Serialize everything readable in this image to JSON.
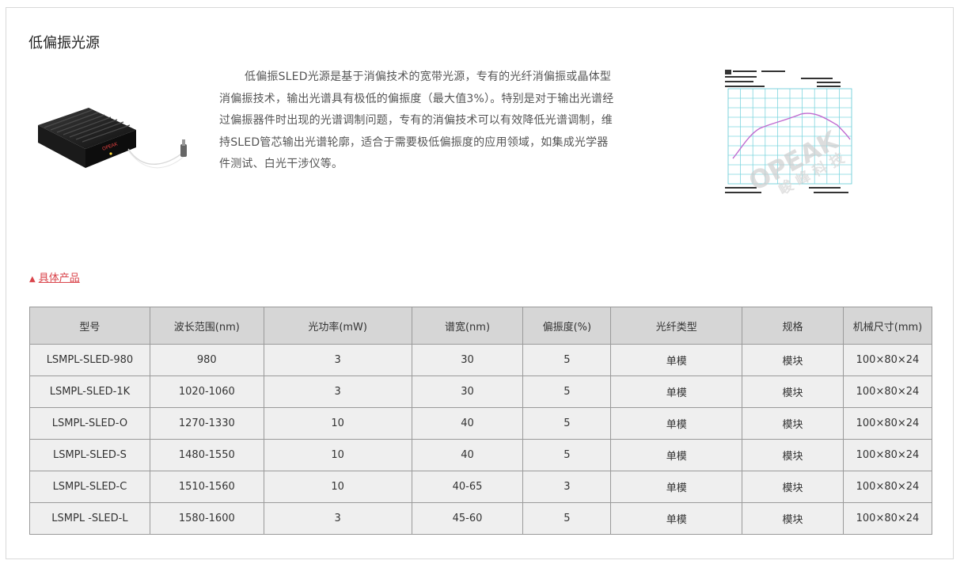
{
  "page": {
    "title": "低偏振光源",
    "description": "低偏振SLED光源是基于消偏技术的宽带光源，专有的光纤消偏振或晶体型消偏振技术，输出光谱具有极低的偏振度（最大值3%）。特别是对于输出光谱经过偏振器件时出现的光谱调制问题，专有的消偏技术可以有效降低光谱调制，维持SLED管芯输出光谱轮廓，适合于需要极低偏振度的应用领域，如集成光学器件测试、白光干涉仪等。",
    "products_link": "具体产品",
    "product_image_label": "OPEAK",
    "spectrum_watermark": "OPEAK",
    "spectrum_watermark_cn": "峻 峰 科 技"
  },
  "colors": {
    "link": "#d9434a",
    "header_bg": "#d6d6d6",
    "cell_bg": "#efefef",
    "border": "#9a9a9a",
    "trace": "#c06ad0",
    "grid": "#7fd6df"
  },
  "table": {
    "headers": [
      "型号",
      "波长范围(nm)",
      "光功率(mW)",
      "谱宽(nm)",
      "偏振度(%)",
      "光纤类型",
      "规格",
      "机械尺寸(mm)"
    ],
    "rows": [
      [
        "LSMPL-SLED-980",
        "980",
        "3",
        "30",
        "5",
        "单模",
        "模块",
        "100×80×24"
      ],
      [
        "LSMPL-SLED-1K",
        "1020-1060",
        "3",
        "30",
        "5",
        "单模",
        "模块",
        "100×80×24"
      ],
      [
        "LSMPL-SLED-O",
        "1270-1330",
        "10",
        "40",
        "5",
        "单模",
        "模块",
        "100×80×24"
      ],
      [
        "LSMPL-SLED-S",
        "1480-1550",
        "10",
        "40",
        "5",
        "单模",
        "模块",
        "100×80×24"
      ],
      [
        "LSMPL-SLED-C",
        "1510-1560",
        "10",
        "40-65",
        "3",
        "单模",
        "模块",
        "100×80×24"
      ],
      [
        "LSMPL -SLED-L",
        "1580-1600",
        "3",
        "45-60",
        "5",
        "单模",
        "模块",
        "100×80×24"
      ]
    ]
  }
}
